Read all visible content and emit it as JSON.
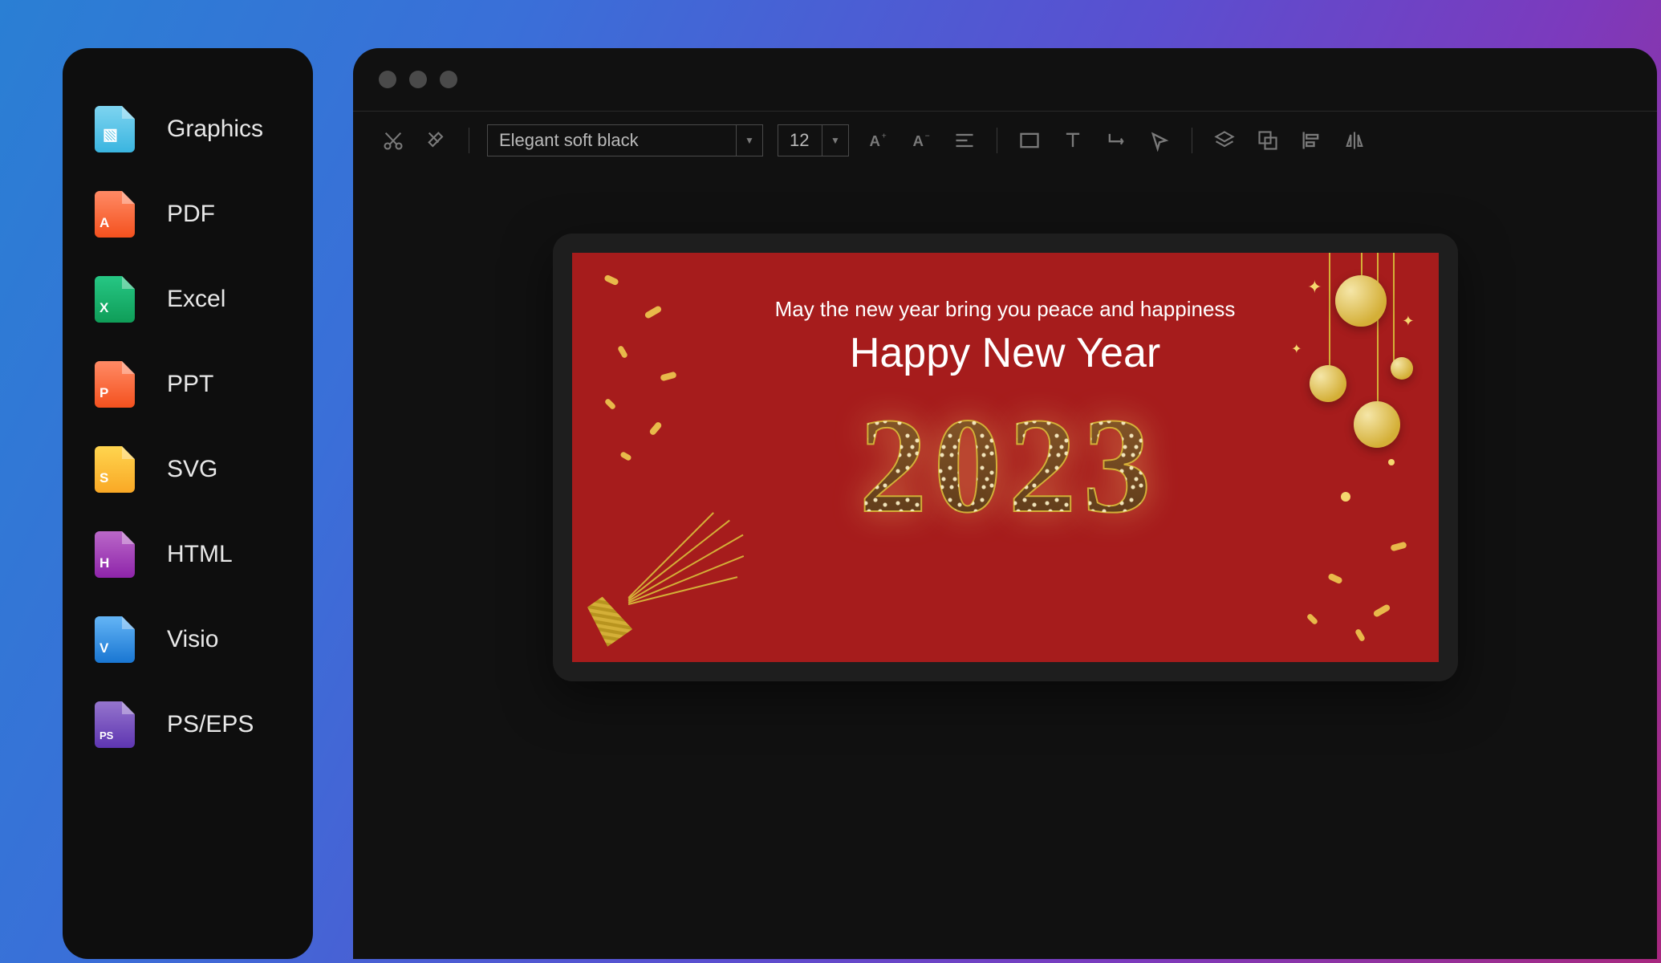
{
  "sidebar": {
    "items": [
      {
        "label": "Graphics",
        "icon": "graphics",
        "badge": "▧"
      },
      {
        "label": "PDF",
        "icon": "pdf",
        "badge": "A"
      },
      {
        "label": "Excel",
        "icon": "excel",
        "badge": "X"
      },
      {
        "label": "PPT",
        "icon": "ppt",
        "badge": "P"
      },
      {
        "label": "SVG",
        "icon": "svg",
        "badge": "S"
      },
      {
        "label": "HTML",
        "icon": "html",
        "badge": "H"
      },
      {
        "label": "Visio",
        "icon": "visio",
        "badge": "V"
      },
      {
        "label": "PS/EPS",
        "icon": "ps",
        "badge": "PS"
      }
    ]
  },
  "toolbar": {
    "font_name": "Elegant soft black",
    "font_size": "12"
  },
  "canvas": {
    "subtitle": "May the new year bring you peace and happiness",
    "title": "Happy New Year",
    "year": "2023",
    "bg_color": "#a61c1c",
    "gold_color": "#d4af37"
  }
}
